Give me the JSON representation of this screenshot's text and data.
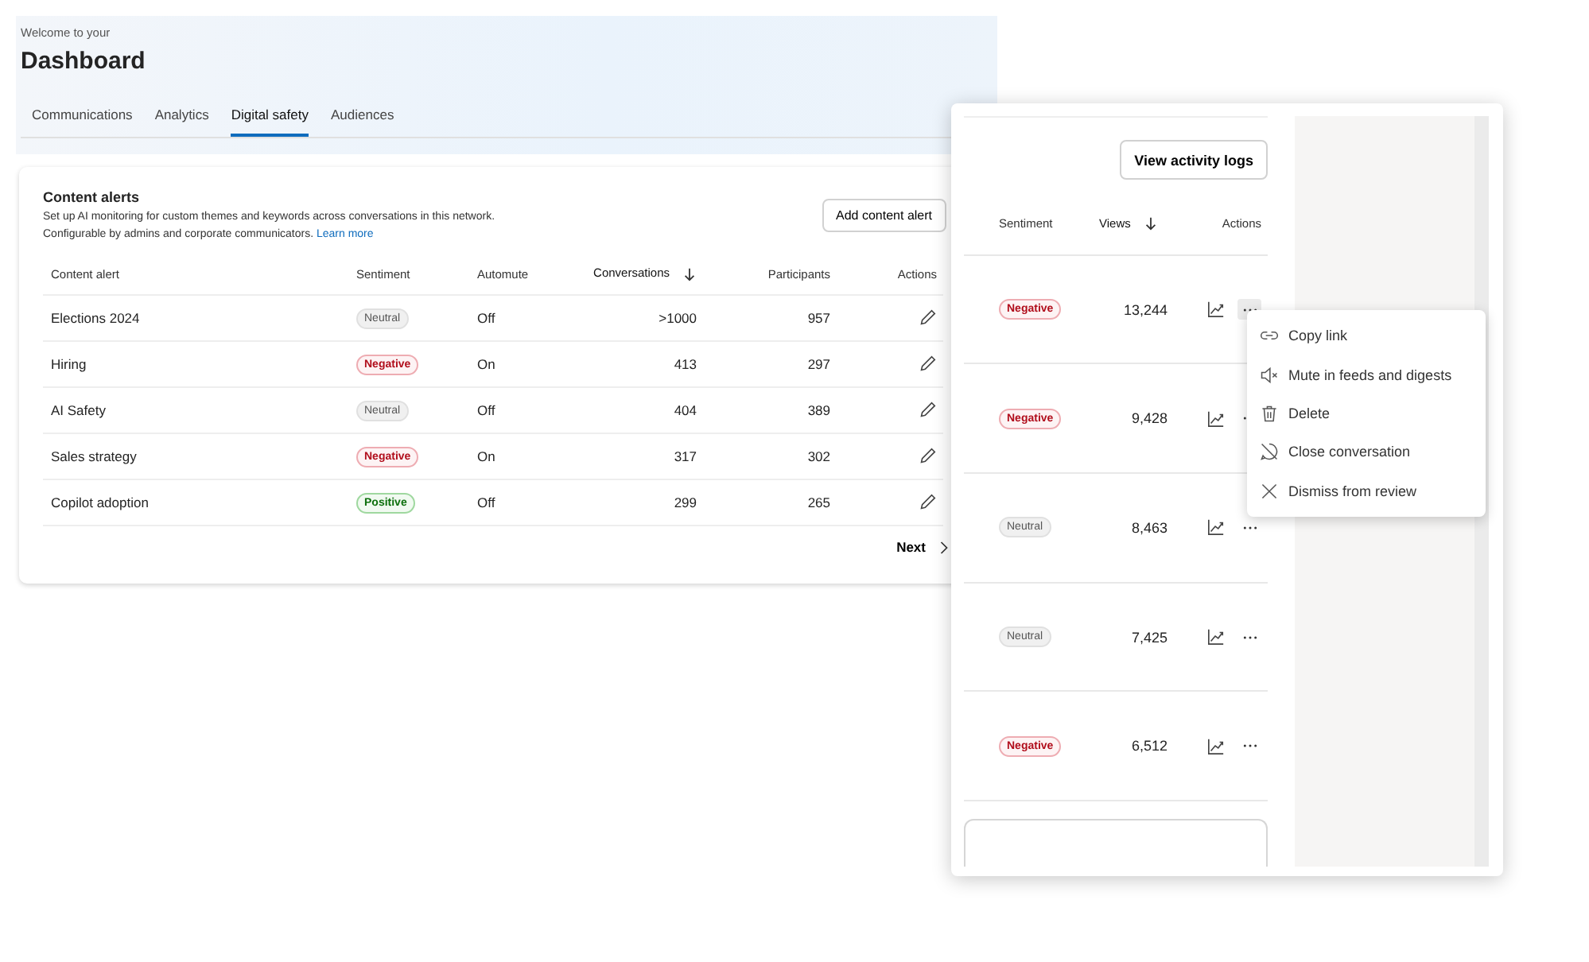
{
  "header": {
    "greeting": "Welcome to your",
    "title": "Dashboard"
  },
  "tabs": [
    {
      "label": "Communications",
      "selected": false
    },
    {
      "label": "Analytics",
      "selected": false
    },
    {
      "label": "Digital safety",
      "selected": true
    },
    {
      "label": "Audiences",
      "selected": false
    }
  ],
  "content_alerts": {
    "title": "Content alerts",
    "description": [
      "Set up AI monitoring for custom themes and keywords across conversations in this network.",
      "Configurable by admins and corporate communicators."
    ],
    "learn_more": "Learn more",
    "add_button": "Add content alert",
    "columns": [
      {
        "label": "Content alert",
        "sorted": false
      },
      {
        "label": "Sentiment",
        "sorted": false
      },
      {
        "label": "Automute",
        "sorted": false
      },
      {
        "label": "Conversations",
        "sorted": true
      },
      {
        "label": "Participants",
        "sorted": false
      },
      {
        "label": "Actions",
        "sorted": false
      }
    ],
    "rows": [
      {
        "name": "Elections 2024",
        "sentiment": {
          "label": "Neutral",
          "kind": "neutral"
        },
        "automute": "Off",
        "conversations": ">1000",
        "participants": "957"
      },
      {
        "name": "Hiring",
        "sentiment": {
          "label": "Negative",
          "kind": "negative"
        },
        "automute": "On",
        "conversations": "413",
        "participants": "297"
      },
      {
        "name": "AI Safety",
        "sentiment": {
          "label": "Neutral",
          "kind": "neutral"
        },
        "automute": "Off",
        "conversations": "404",
        "participants": "389"
      },
      {
        "name": "Sales strategy",
        "sentiment": {
          "label": "Negative",
          "kind": "negative"
        },
        "automute": "On",
        "conversations": "317",
        "participants": "302"
      },
      {
        "name": "Copilot adoption",
        "sentiment": {
          "label": "Positive",
          "kind": "positive"
        },
        "automute": "Off",
        "conversations": "299",
        "participants": "265"
      }
    ],
    "next": "Next"
  },
  "activity_panel": {
    "button": "View activity logs",
    "columns": [
      {
        "label": "Sentiment",
        "sorted": false
      },
      {
        "label": "Views",
        "sorted": true
      },
      {
        "label": "Actions",
        "sorted": false
      }
    ],
    "rows": [
      {
        "sentiment": {
          "label": "Negative",
          "kind": "negative"
        },
        "views": "13,244",
        "menu_open": true
      },
      {
        "sentiment": {
          "label": "Negative",
          "kind": "negative"
        },
        "views": "9,428",
        "menu_open": false
      },
      {
        "sentiment": {
          "label": "Neutral",
          "kind": "neutral"
        },
        "views": "8,463",
        "menu_open": false
      },
      {
        "sentiment": {
          "label": "Neutral",
          "kind": "neutral"
        },
        "views": "7,425",
        "menu_open": false
      },
      {
        "sentiment": {
          "label": "Negative",
          "kind": "negative"
        },
        "views": "6,512",
        "menu_open": false
      }
    ],
    "menu": [
      {
        "label": "Copy link",
        "kind": "link"
      },
      {
        "label": "Mute in feeds and digests",
        "kind": "mute"
      },
      {
        "label": "Delete",
        "kind": "delete"
      },
      {
        "label": "Close conversation",
        "kind": "close"
      },
      {
        "label": "Dismiss from review",
        "kind": "dismiss"
      }
    ]
  }
}
